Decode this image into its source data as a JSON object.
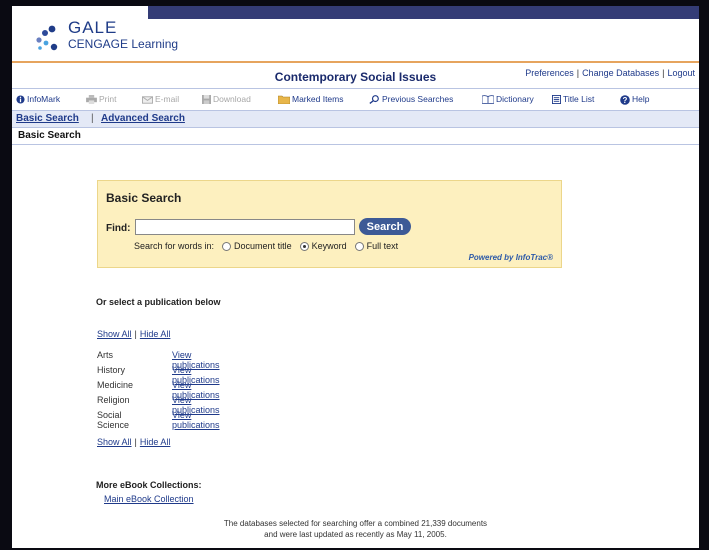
{
  "logo": {
    "line1": "GALE",
    "line2": "CENGAGE Learning",
    "brand_color": "#1f3c88"
  },
  "header": {
    "title": "Contemporary Social Issues",
    "links": [
      "Preferences",
      "Change Databases",
      "Logout"
    ],
    "separator": "|"
  },
  "toolbar": [
    {
      "label": "InfoMark",
      "icon": "infomark-icon",
      "enabled": true
    },
    {
      "label": "Print",
      "icon": "printer-icon",
      "enabled": false
    },
    {
      "label": "E-mail",
      "icon": "envelope-icon",
      "enabled": false
    },
    {
      "label": "Download",
      "icon": "disk-icon",
      "enabled": false
    },
    {
      "label": "Marked Items",
      "icon": "folder-icon",
      "enabled": true
    },
    {
      "label": "Previous Searches",
      "icon": "magnifier-icon",
      "enabled": true
    },
    {
      "label": "Dictionary",
      "icon": "book-icon",
      "enabled": true
    },
    {
      "label": "Title List",
      "icon": "list-icon",
      "enabled": true
    },
    {
      "label": "Help",
      "icon": "help-icon",
      "enabled": true
    }
  ],
  "nav": {
    "basic": "Basic Search",
    "advanced": "Advanced Search",
    "separator": "|"
  },
  "breadcrumb": "Basic Search",
  "search": {
    "title": "Basic Search",
    "find_label": "Find:",
    "input_value": "",
    "button_label": "Search",
    "search_words_in": "Search for words in:",
    "options": [
      {
        "label": "Document title",
        "selected": false
      },
      {
        "label": "Keyword",
        "selected": true
      },
      {
        "label": "Full text",
        "selected": false
      }
    ],
    "powered_by": "Powered by InfoTrac®"
  },
  "publications": {
    "heading": "Or select a publication below",
    "show_all": "Show All",
    "hide_all": "Hide All",
    "separator": "|",
    "categories": [
      {
        "name": "Arts",
        "link": "View publications"
      },
      {
        "name": "History",
        "link": "View publications"
      },
      {
        "name": "Medicine",
        "link": "View publications"
      },
      {
        "name": "Religion",
        "link": "View publications"
      },
      {
        "name": "Social Science",
        "link": "View publications"
      }
    ]
  },
  "ebooks": {
    "heading": "More eBook Collections:",
    "link": "Main eBook Collection"
  },
  "footer": {
    "line1": "The databases selected for searching offer a combined 21,339 documents",
    "line2": "and were last updated as recently as May 11, 2005."
  },
  "colors": {
    "accent_orange": "#e6a45e",
    "search_panel": "#fdf0bf",
    "nav_bar": "#e4e9f6",
    "link": "#1f3a8a"
  }
}
